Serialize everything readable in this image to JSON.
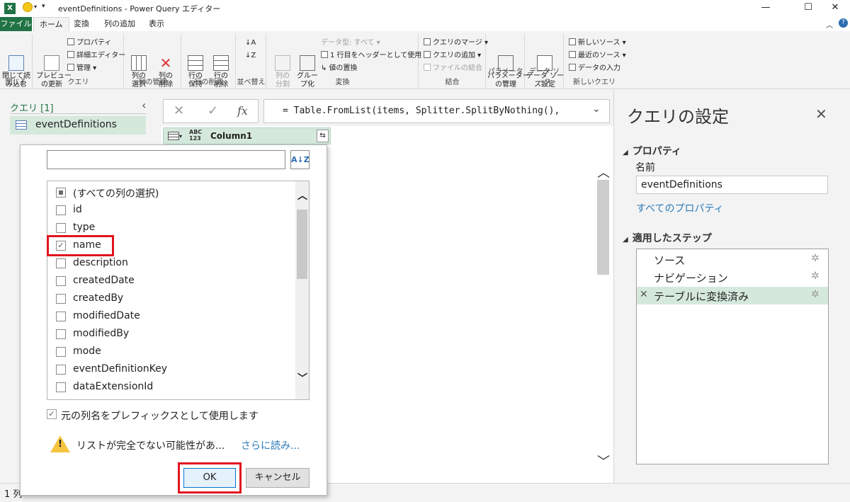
{
  "window": {
    "title": "eventDefinitions - Power Query エディター",
    "minimize": "—",
    "maximize": "☐",
    "close": "✕"
  },
  "tabs": [
    "ファイル",
    "ホーム",
    "変換",
    "列の追加",
    "表示"
  ],
  "ribbon": {
    "close_group": {
      "button": "閉じて読\nみ込む",
      "label": "閉じる"
    },
    "query_group": {
      "preview": "プレビュー\nの更新",
      "properties": "プロパティ",
      "advanced_editor": "詳細エディター",
      "manage": "管理",
      "label": "クエリ"
    },
    "columns_group": {
      "select": "列の\n選択",
      "remove": "列の\n削除",
      "label": "列の管理"
    },
    "rows_group": {
      "keep": "行の\n保持",
      "remove": "行の\n削除",
      "label": "行の削減"
    },
    "sort_group": {
      "label": "並べ替え"
    },
    "transform_group": {
      "split": "列の\n分割",
      "group": "グルー\nプ化",
      "data_type": "データ型: すべて",
      "first_row": "1 行目をヘッダーとして使用",
      "replace": "値の置換",
      "label": "変換"
    },
    "combine_group": {
      "merge": "クエリのマージ",
      "append": "クエリの追加",
      "combine_files": "ファイルの結合",
      "label": "結合"
    },
    "params_group": {
      "manage": "パラメーター\nの管理",
      "label": "パラメーター"
    },
    "datasource_group": {
      "settings": "データ ソー\nス設定",
      "label": "データ ソース"
    },
    "newquery_group": {
      "new_source": "新しいソース",
      "recent": "最近のソース",
      "enter_data": "データの入力",
      "label": "新しいクエリ"
    }
  },
  "queries_pane": {
    "title": "クエリ [1]",
    "items": [
      "eventDefinitions"
    ]
  },
  "formula_bar": {
    "fx": "fx",
    "formula": "= Table.FromList(items, Splitter.SplitByNothing(),"
  },
  "grid": {
    "column_type": "ABC\n123",
    "column_name": "Column1"
  },
  "popup": {
    "search_value": "",
    "select_all": "(すべての列の選択)",
    "columns": [
      {
        "label": "id",
        "checked": false
      },
      {
        "label": "type",
        "checked": false
      },
      {
        "label": "name",
        "checked": true
      },
      {
        "label": "description",
        "checked": false
      },
      {
        "label": "createdDate",
        "checked": false
      },
      {
        "label": "createdBy",
        "checked": false
      },
      {
        "label": "modifiedDate",
        "checked": false
      },
      {
        "label": "modifiedBy",
        "checked": false
      },
      {
        "label": "mode",
        "checked": false
      },
      {
        "label": "eventDefinitionKey",
        "checked": false
      },
      {
        "label": "dataExtensionId",
        "checked": false
      }
    ],
    "prefix_option": "元の列名をプレフィックスとして使用します",
    "prefix_checked": true,
    "warning": "リストが完全でない可能性があ...",
    "read_more": "さらに読み...",
    "ok": "OK",
    "cancel": "キャンセル"
  },
  "settings": {
    "title": "クエリの設定",
    "properties_header": "プロパティ",
    "name_label": "名前",
    "name_value": "eventDefinitions",
    "all_properties": "すべてのプロパティ",
    "steps_header": "適用したステップ",
    "steps": [
      "ソース",
      "ナビゲーション",
      "テーブルに変換済み"
    ]
  },
  "statusbar": {
    "text": "1 列"
  },
  "colors": {
    "accent": "#217346",
    "highlight": "#d5e8dc",
    "red_box": "#e0141e",
    "link": "#2b7bb9"
  }
}
